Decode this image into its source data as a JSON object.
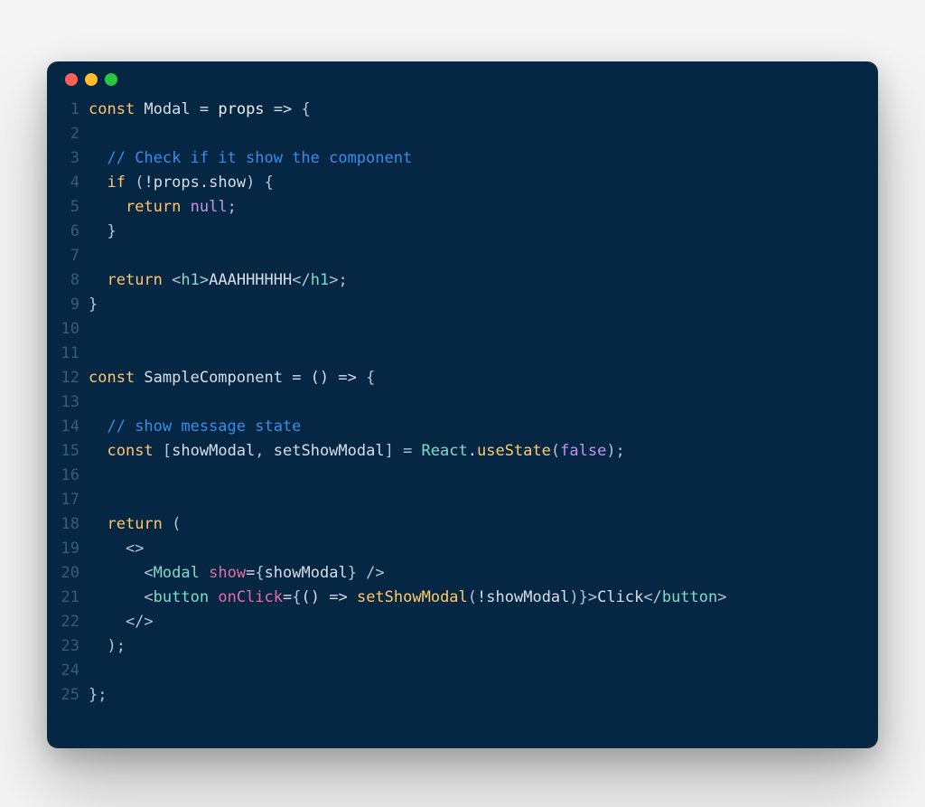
{
  "code": {
    "lines": [
      [
        {
          "t": "const ",
          "c": "tk-kw"
        },
        {
          "t": "Modal",
          "c": "tk-name"
        },
        {
          "t": " ",
          "c": "tk-op"
        },
        {
          "t": "=",
          "c": "tk-op"
        },
        {
          "t": " ",
          "c": ""
        },
        {
          "t": "props",
          "c": "tk-param"
        },
        {
          "t": " ",
          "c": ""
        },
        {
          "t": "=>",
          "c": "tk-op"
        },
        {
          "t": " {",
          "c": "tk-punct"
        }
      ],
      [
        {
          "t": "",
          "c": ""
        }
      ],
      [
        {
          "t": "  ",
          "c": ""
        },
        {
          "t": "// Check if it show the component",
          "c": "tk-comment"
        }
      ],
      [
        {
          "t": "  ",
          "c": ""
        },
        {
          "t": "if",
          "c": "tk-kw"
        },
        {
          "t": " (",
          "c": "tk-punct"
        },
        {
          "t": "!",
          "c": "tk-op"
        },
        {
          "t": "props",
          "c": "tk-name"
        },
        {
          "t": ".",
          "c": "tk-op"
        },
        {
          "t": "show",
          "c": "tk-name"
        },
        {
          "t": ") {",
          "c": "tk-punct"
        }
      ],
      [
        {
          "t": "    ",
          "c": ""
        },
        {
          "t": "return ",
          "c": "tk-kw"
        },
        {
          "t": "null",
          "c": "tk-null"
        },
        {
          "t": ";",
          "c": "tk-punct"
        }
      ],
      [
        {
          "t": "  }",
          "c": "tk-punct"
        }
      ],
      [
        {
          "t": "",
          "c": ""
        }
      ],
      [
        {
          "t": "  ",
          "c": ""
        },
        {
          "t": "return ",
          "c": "tk-kw"
        },
        {
          "t": "<",
          "c": "tk-angle"
        },
        {
          "t": "h1",
          "c": "tk-tag"
        },
        {
          "t": ">",
          "c": "tk-angle"
        },
        {
          "t": "AAAHHHHHH",
          "c": "tk-text"
        },
        {
          "t": "</",
          "c": "tk-angle"
        },
        {
          "t": "h1",
          "c": "tk-tag"
        },
        {
          "t": ">",
          "c": "tk-angle"
        },
        {
          "t": ";",
          "c": "tk-punct"
        }
      ],
      [
        {
          "t": "}",
          "c": "tk-punct"
        }
      ],
      [
        {
          "t": "",
          "c": ""
        }
      ],
      [
        {
          "t": "",
          "c": ""
        }
      ],
      [
        {
          "t": "const ",
          "c": "tk-kw"
        },
        {
          "t": "SampleComponent",
          "c": "tk-name"
        },
        {
          "t": " = () ",
          "c": "tk-op"
        },
        {
          "t": "=>",
          "c": "tk-op"
        },
        {
          "t": " {",
          "c": "tk-punct"
        }
      ],
      [
        {
          "t": "",
          "c": ""
        }
      ],
      [
        {
          "t": "  ",
          "c": ""
        },
        {
          "t": "// show message state",
          "c": "tk-comment"
        }
      ],
      [
        {
          "t": "  ",
          "c": ""
        },
        {
          "t": "const ",
          "c": "tk-kw"
        },
        {
          "t": "[",
          "c": "tk-punct"
        },
        {
          "t": "showModal",
          "c": "tk-name"
        },
        {
          "t": ", ",
          "c": "tk-punct"
        },
        {
          "t": "setShowModal",
          "c": "tk-name"
        },
        {
          "t": "] = ",
          "c": "tk-punct"
        },
        {
          "t": "React",
          "c": "tk-react"
        },
        {
          "t": ".",
          "c": "tk-op"
        },
        {
          "t": "useState",
          "c": "tk-call"
        },
        {
          "t": "(",
          "c": "tk-punct"
        },
        {
          "t": "false",
          "c": "tk-false"
        },
        {
          "t": ");",
          "c": "tk-punct"
        }
      ],
      [
        {
          "t": "",
          "c": ""
        }
      ],
      [
        {
          "t": "",
          "c": ""
        }
      ],
      [
        {
          "t": "  ",
          "c": ""
        },
        {
          "t": "return ",
          "c": "tk-kw"
        },
        {
          "t": "(",
          "c": "tk-punct"
        }
      ],
      [
        {
          "t": "    ",
          "c": ""
        },
        {
          "t": "<>",
          "c": "tk-angle"
        }
      ],
      [
        {
          "t": "      ",
          "c": ""
        },
        {
          "t": "<",
          "c": "tk-angle"
        },
        {
          "t": "Modal",
          "c": "tk-tag"
        },
        {
          "t": " ",
          "c": ""
        },
        {
          "t": "show",
          "c": "tk-attr"
        },
        {
          "t": "=",
          "c": "tk-op"
        },
        {
          "t": "{",
          "c": "tk-punct"
        },
        {
          "t": "showModal",
          "c": "tk-name"
        },
        {
          "t": "}",
          "c": "tk-punct"
        },
        {
          "t": " />",
          "c": "tk-angle"
        }
      ],
      [
        {
          "t": "      ",
          "c": ""
        },
        {
          "t": "<",
          "c": "tk-angle"
        },
        {
          "t": "button",
          "c": "tk-tag"
        },
        {
          "t": " ",
          "c": ""
        },
        {
          "t": "onClick",
          "c": "tk-attr"
        },
        {
          "t": "=",
          "c": "tk-op"
        },
        {
          "t": "{",
          "c": "tk-punct"
        },
        {
          "t": "() ",
          "c": "tk-op"
        },
        {
          "t": "=>",
          "c": "tk-op"
        },
        {
          "t": " ",
          "c": ""
        },
        {
          "t": "setShowModal",
          "c": "tk-call"
        },
        {
          "t": "(",
          "c": "tk-punct"
        },
        {
          "t": "!",
          "c": "tk-op"
        },
        {
          "t": "showModal",
          "c": "tk-name"
        },
        {
          "t": ")",
          "c": "tk-punct"
        },
        {
          "t": "}",
          "c": "tk-punct"
        },
        {
          "t": ">",
          "c": "tk-angle"
        },
        {
          "t": "Click",
          "c": "tk-text"
        },
        {
          "t": "</",
          "c": "tk-angle"
        },
        {
          "t": "button",
          "c": "tk-tag"
        },
        {
          "t": ">",
          "c": "tk-angle"
        }
      ],
      [
        {
          "t": "    ",
          "c": ""
        },
        {
          "t": "</>",
          "c": "tk-angle"
        }
      ],
      [
        {
          "t": "  );",
          "c": "tk-punct"
        }
      ],
      [
        {
          "t": "",
          "c": ""
        }
      ],
      [
        {
          "t": "};",
          "c": "tk-punct"
        }
      ]
    ]
  },
  "colors": {
    "bg": "#052744",
    "red": "#ff5f57",
    "yellow": "#febc2e",
    "green": "#28c840"
  }
}
